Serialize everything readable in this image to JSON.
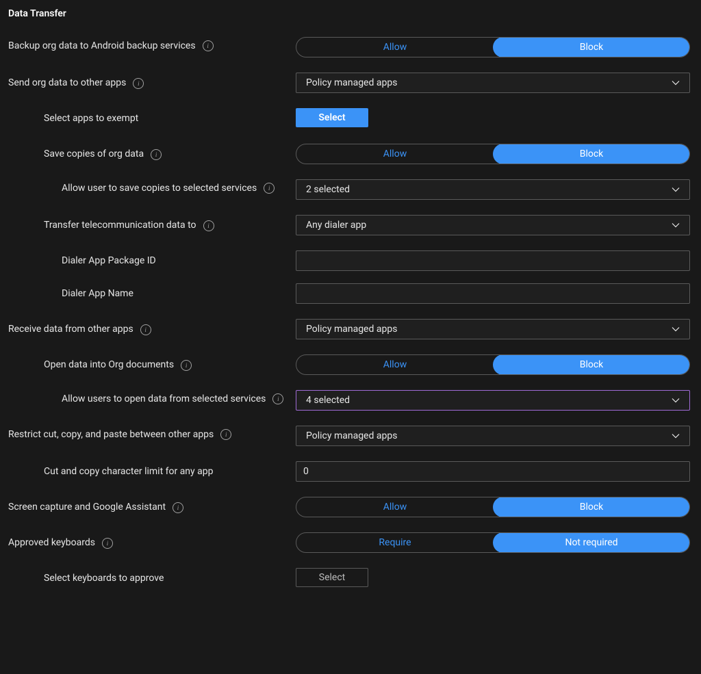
{
  "section_title": "Data Transfer",
  "rows": {
    "backup": {
      "label": "Backup org data to Android backup services",
      "allow": "Allow",
      "block": "Block",
      "selected": "block"
    },
    "send_other": {
      "label": "Send org data to other apps",
      "value": "Policy managed apps"
    },
    "exempt": {
      "label": "Select apps to exempt",
      "button": "Select"
    },
    "save_copies": {
      "label": "Save copies of org data",
      "allow": "Allow",
      "block": "Block",
      "selected": "block"
    },
    "save_services": {
      "label": "Allow user to save copies to selected services",
      "value": "2 selected"
    },
    "telecom": {
      "label": "Transfer telecommunication data to",
      "value": "Any dialer app"
    },
    "dialer_pkg": {
      "label": "Dialer App Package ID",
      "value": ""
    },
    "dialer_name": {
      "label": "Dialer App Name",
      "value": ""
    },
    "receive_other": {
      "label": "Receive data from other apps",
      "value": "Policy managed apps"
    },
    "open_docs": {
      "label": "Open data into Org documents",
      "allow": "Allow",
      "block": "Block",
      "selected": "block"
    },
    "open_services": {
      "label": "Allow users to open data from selected services",
      "value": "4 selected"
    },
    "restrict_ccp": {
      "label": "Restrict cut, copy, and paste between other apps",
      "value": "Policy managed apps"
    },
    "ccp_limit": {
      "label": "Cut and copy character limit for any app",
      "value": "0"
    },
    "screen_cap": {
      "label": "Screen capture and Google Assistant",
      "allow": "Allow",
      "block": "Block",
      "selected": "block"
    },
    "keyboards": {
      "label": "Approved keyboards",
      "require": "Require",
      "not_required": "Not required",
      "selected": "not_required"
    },
    "keyboards_select": {
      "label": "Select keyboards to approve",
      "button": "Select"
    }
  }
}
